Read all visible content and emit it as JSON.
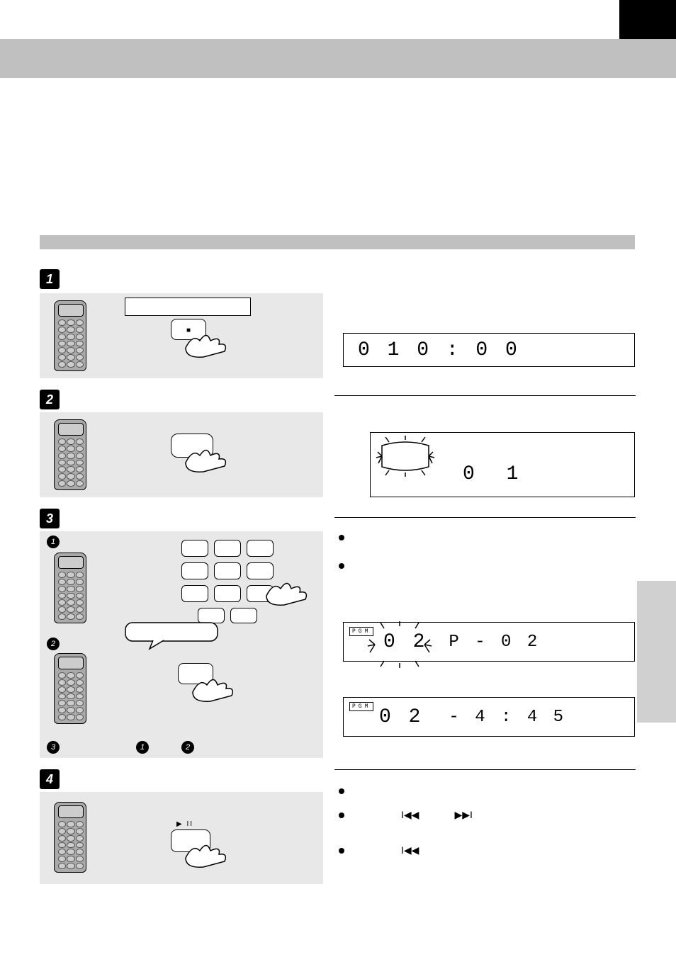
{
  "steps": {
    "s1": "1",
    "s2": "2",
    "s3": "3",
    "s4": "4"
  },
  "subs": {
    "a": "1",
    "b": "2",
    "c": "3"
  },
  "display1": "0 1    0 : 0 0",
  "display2": "0  1",
  "display3_track": "0 2",
  "display3_prog": "P -  0 2",
  "display4_track": "0 2",
  "display4_time": "- 4 : 4 5",
  "pgm_label": "PGM",
  "icons": {
    "stop": "■",
    "play_pause": "▶  II",
    "prev": "I◀◀",
    "next": "▶▶I"
  }
}
